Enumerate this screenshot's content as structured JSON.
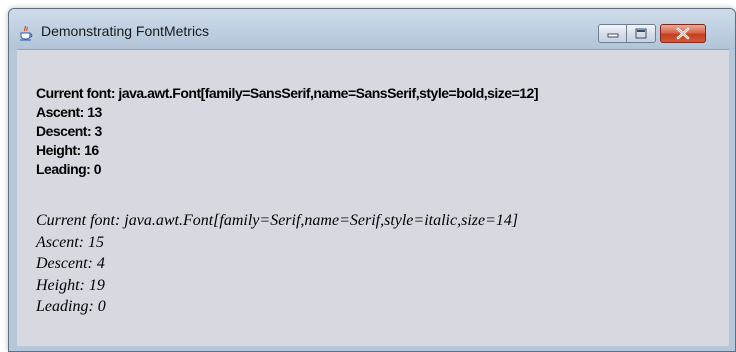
{
  "window": {
    "title": "Demonstrating FontMetrics",
    "app_icon": "java-icon",
    "controls": [
      "minimize-icon",
      "maximize-icon",
      "close-icon"
    ]
  },
  "sans_metrics": {
    "current_font": "Current font: java.awt.Font[family=SansSerif,name=SansSerif,style=bold,size=12]",
    "ascent": "Ascent: 13",
    "descent": "Descent: 3",
    "height": "Height: 16",
    "leading": "Leading: 0"
  },
  "serif_metrics": {
    "current_font": "Current font: java.awt.Font[family=Serif,name=Serif,style=italic,size=14]",
    "ascent": "Ascent: 15",
    "descent": "Descent: 4",
    "height": "Height: 19",
    "leading": "Leading: 0"
  },
  "colors": {
    "frame": "#b7c7da",
    "content_background": "#d6d9df",
    "close_button": "#c3401f"
  }
}
